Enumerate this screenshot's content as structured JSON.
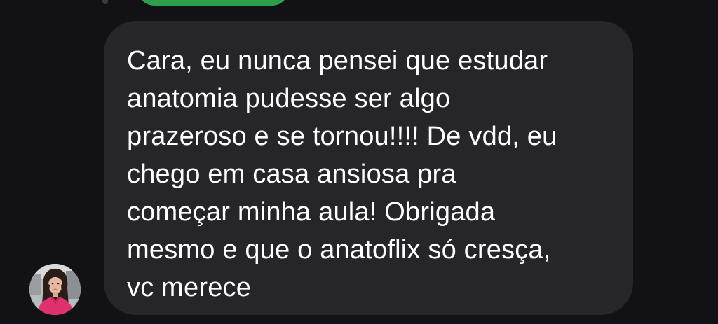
{
  "conversation": {
    "previous_message": {
      "sender": "outgoing",
      "bubble_color": "#2e9e4a"
    },
    "incoming_message": {
      "text": "Cara, eu nunca pensei que estudar\nanatomia pudesse ser algo\nprazeroso e se tornou!!!! De vdd, eu\nchego em casa ansiosa pra\ncomeçar minha aula! Obrigada\nmesmo e que o anatoflix só cresça,\nvc merece",
      "bubble_color": "#26262a",
      "text_color": "#ffffff"
    },
    "sender_avatar": {
      "icon": "profile-photo"
    }
  },
  "theme": {
    "background": "#121216"
  }
}
